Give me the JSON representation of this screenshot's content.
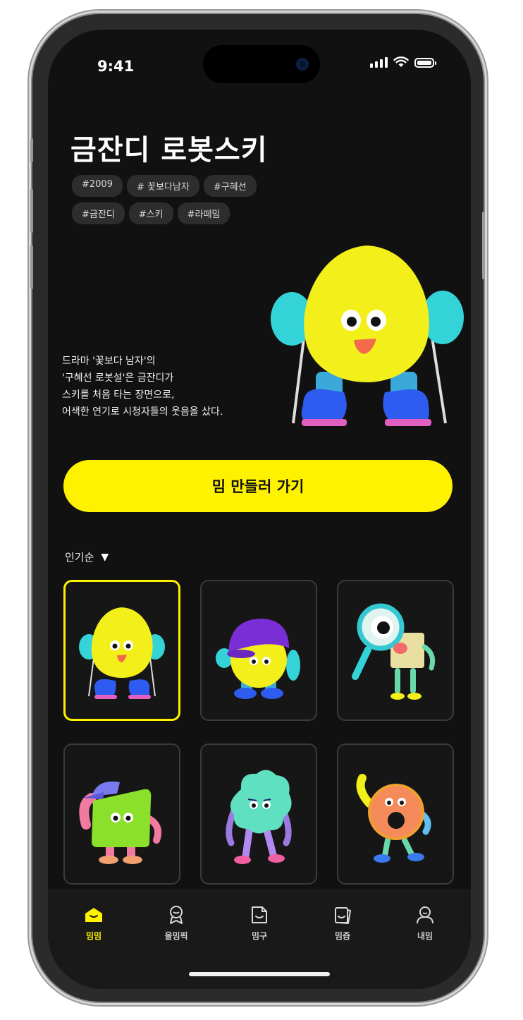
{
  "status_bar": {
    "time": "9:41"
  },
  "header": {
    "title": "금잔디 로봇스키",
    "tags": [
      "#2009",
      "# 꽃보다남자",
      "#구혜선",
      "#금잔디",
      "#스키",
      "#라떼밈"
    ]
  },
  "description": {
    "lines": [
      "드라마 '꽃보다 남자'의",
      "'구혜선 로봇설'은 금잔디가",
      "스키를 처음 타는 장면으로,",
      "어색한 연기로 시청자들의 웃음을 샀다."
    ]
  },
  "cta": {
    "label": "밈 만들러 가기"
  },
  "sort": {
    "label": "인기순",
    "arrow": "▼"
  },
  "gallery": {
    "items": [
      {
        "icon": "yellow-ski-character-icon",
        "selected": true
      },
      {
        "icon": "purple-hat-character-icon",
        "selected": false
      },
      {
        "icon": "magnifier-character-icon",
        "selected": false
      },
      {
        "icon": "green-cap-character-icon",
        "selected": false
      },
      {
        "icon": "mint-cloud-character-icon",
        "selected": false
      },
      {
        "icon": "donut-character-icon",
        "selected": false
      }
    ]
  },
  "tabbar": {
    "items": [
      {
        "label": "밈밈",
        "icon": "home-icon",
        "active": true
      },
      {
        "label": "올밈픽",
        "icon": "medal-icon",
        "active": false
      },
      {
        "label": "밈구",
        "icon": "sticker-icon",
        "active": false
      },
      {
        "label": "밈즙",
        "icon": "cards-icon",
        "active": false
      },
      {
        "label": "내밈",
        "icon": "profile-icon",
        "active": false
      }
    ]
  },
  "colors": {
    "accent": "#fff200",
    "background": "#111111",
    "tag_bg": "#2d2d2d"
  }
}
